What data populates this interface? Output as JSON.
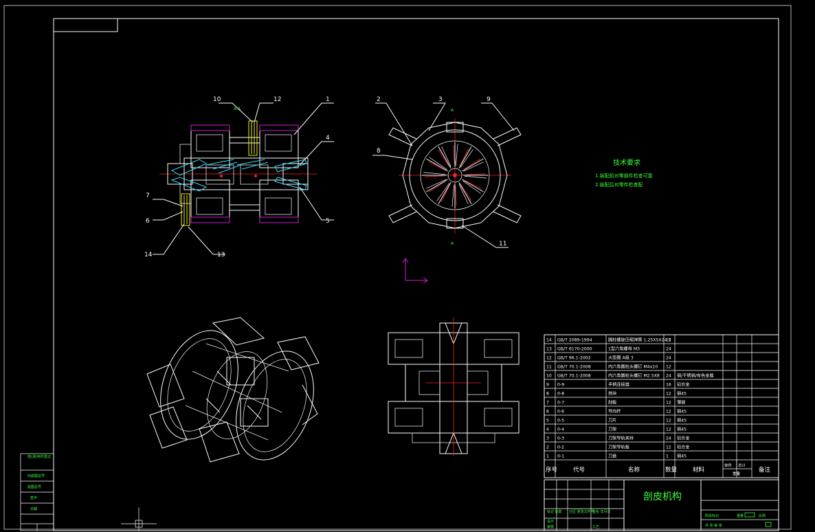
{
  "drawing": {
    "title": "剖皮机构",
    "colors": {
      "background": "#000000",
      "line": "#ffffff",
      "note": "#3cff3c",
      "center": "#ff2020",
      "spring": "#30e0ff",
      "hatch": "#d020d0",
      "bolt": "#f0f020",
      "ucs": "#d020d0"
    }
  },
  "tech_req": {
    "heading": "技术要求",
    "line1": "1.装配前对零部件检查可靠",
    "line2": "2.装配后对零件检查配"
  },
  "view_labels": {
    "sec_a": "A-A",
    "view_a_top": "A",
    "view_a_bottom": "A"
  },
  "balloons": {
    "b1": "1",
    "b2": "2",
    "b3": "3",
    "b4": "4",
    "b5": "5",
    "b6": "6",
    "b7": "7",
    "b8": "8",
    "b9": "9",
    "b10": "10",
    "b11": "11",
    "b12": "12",
    "b13": "13",
    "b14": "14"
  },
  "bom": {
    "rows": [
      {
        "no": "14",
        "code": "GB/T 2089-1994",
        "name": "圆柱螺旋压缩弹簧 1.25X5X24.5",
        "qty": "12",
        "mat": ""
      },
      {
        "no": "13",
        "code": "GB/T 6170-2000",
        "name": "1型六角螺母 M3",
        "qty": "24",
        "mat": ""
      },
      {
        "no": "12",
        "code": "GB/T 96.1-2002",
        "name": "大垫圈 A级 3",
        "qty": "24",
        "mat": ""
      },
      {
        "no": "11",
        "code": "GB/T 70.1-2008",
        "name": "内六角圆柱头螺钉 M4x10",
        "qty": "12",
        "mat": ""
      },
      {
        "no": "10",
        "code": "GB/T 70.1-2008",
        "name": "内六角圆柱头螺钉 M2.5X8",
        "qty": "24",
        "mat": "钢/不锈钢/有色金属"
      },
      {
        "no": "9",
        "code": "0-9",
        "name": "手柄连接器",
        "qty": "16",
        "mat": "铝合金"
      },
      {
        "no": "8",
        "code": "0-8",
        "name": "挡块",
        "qty": "12",
        "mat": "钢45"
      },
      {
        "no": "7",
        "code": "0-7",
        "name": "刮板",
        "qty": "12",
        "mat": "薄钢"
      },
      {
        "no": "6",
        "code": "0-6",
        "name": "导向杆",
        "qty": "12",
        "mat": "钢45"
      },
      {
        "no": "5",
        "code": "0-5",
        "name": "刀片",
        "qty": "12",
        "mat": "钢45"
      },
      {
        "no": "4",
        "code": "0-4",
        "name": "刀架",
        "qty": "12",
        "mat": "钢45"
      },
      {
        "no": "3",
        "code": "0-3",
        "name": "刀架导轨夹持",
        "qty": "24",
        "mat": "铝合金"
      },
      {
        "no": "2",
        "code": "0-2",
        "name": "刀架导轨板",
        "qty": "12",
        "mat": "铝合金"
      },
      {
        "no": "1",
        "code": "0-1",
        "name": "刀盘",
        "qty": "1",
        "mat": "钢45"
      }
    ],
    "header": {
      "no": "序号",
      "code": "代号",
      "name": "名称",
      "qty": "数量",
      "mat": "材料",
      "unit_w": "单件",
      "total_w": "总计",
      "weight": "重量",
      "remark": "备注"
    }
  },
  "title_block": {
    "left_row1": "标记 处数",
    "left_row1b": "分区 更改文件号",
    "left_row1c": "签名 年月日",
    "left_row2a": "设计",
    "left_row2b": "审核",
    "left_row2c": "工艺",
    "stage_label": "阶段标记",
    "weight_label": "重量",
    "scale_label": "比例",
    "sheet_label": "共 张 第 张"
  },
  "side_strip": {
    "r1": "借(通)用件登记",
    "r2": "旧底图总号",
    "r3": "底图总号",
    "r4": "签字",
    "r5": "日期"
  }
}
